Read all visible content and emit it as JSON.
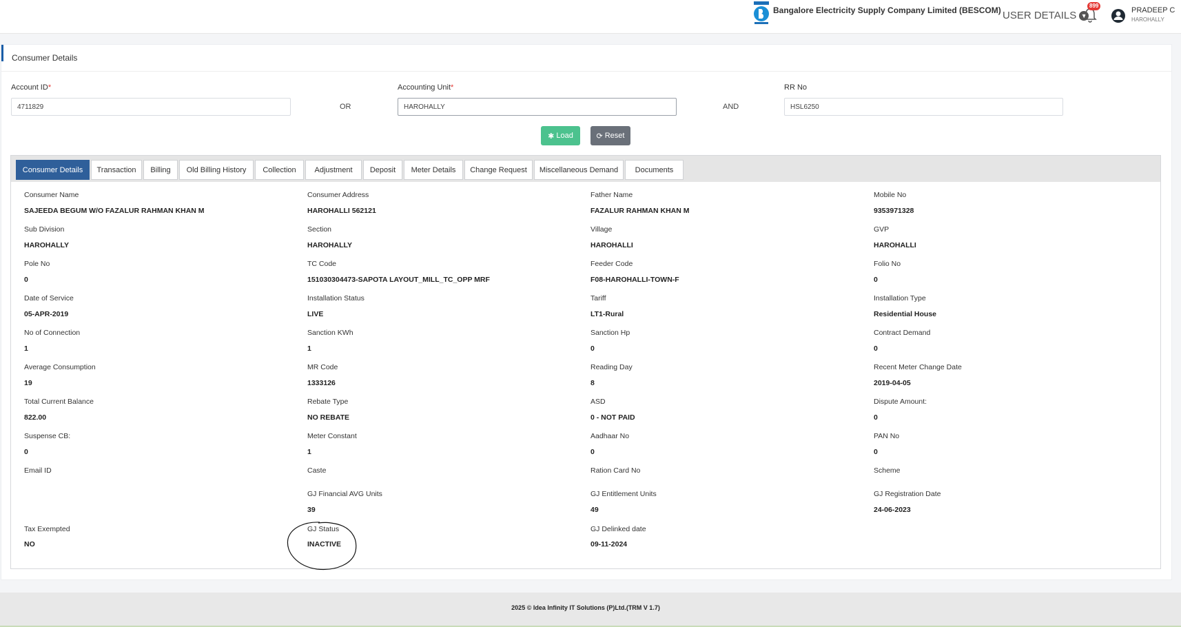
{
  "header": {
    "company_name": "Bangalore Electricity Supply Company Limited (BESCOM)",
    "user_details_label": "USER DETAILS",
    "notification_count": "899",
    "user_name": "PRADEEP C",
    "user_location": "HAROHALLY"
  },
  "page": {
    "title": "Consumer Details"
  },
  "search": {
    "account_id_label": "Account ID",
    "account_id_value": "4711829",
    "or_label": "OR",
    "accounting_unit_label": "Accounting Unit",
    "accounting_unit_value": "HAROHALLY",
    "and_label": "AND",
    "rr_no_label": "RR No",
    "rr_no_value": "HSL6250",
    "required_mark": "*",
    "load_label": "Load",
    "reset_label": "Reset"
  },
  "tabs": [
    {
      "label": "Consumer Details",
      "active": true
    },
    {
      "label": "Transaction"
    },
    {
      "label": "Billing"
    },
    {
      "label": "Old Billing History"
    },
    {
      "label": "Collection"
    },
    {
      "label": "Adjustment"
    },
    {
      "label": "Deposit"
    },
    {
      "label": "Meter Details"
    },
    {
      "label": "Change Request"
    },
    {
      "label": "Miscellaneous Demand"
    },
    {
      "label": "Documents"
    }
  ],
  "details": {
    "consumer_name": {
      "label": "Consumer Name",
      "value": "SAJEEDA BEGUM W/O FAZALUR RAHMAN KHAN M"
    },
    "consumer_address": {
      "label": "Consumer Address",
      "value": "HAROHALLI 562121"
    },
    "father_name": {
      "label": "Father Name",
      "value": "FAZALUR RAHMAN KHAN M"
    },
    "mobile_no": {
      "label": "Mobile No",
      "value": "9353971328"
    },
    "sub_division": {
      "label": "Sub Division",
      "value": "HAROHALLY"
    },
    "section": {
      "label": "Section",
      "value": "HAROHALLY"
    },
    "village": {
      "label": "Village",
      "value": "HAROHALLI"
    },
    "gvp": {
      "label": "GVP",
      "value": "HAROHALLI"
    },
    "pole_no": {
      "label": "Pole No",
      "value": "0"
    },
    "tc_code": {
      "label": "TC Code",
      "value": "151030304473-SAPOTA LAYOUT_MILL_TC_OPP MRF"
    },
    "feeder_code": {
      "label": "Feeder Code",
      "value": "F08-HAROHALLI-TOWN-F"
    },
    "folio_no": {
      "label": "Folio No",
      "value": "0"
    },
    "date_of_service": {
      "label": "Date of Service",
      "value": "05-APR-2019"
    },
    "installation_status": {
      "label": "Installation Status",
      "value": "LIVE"
    },
    "tariff": {
      "label": "Tariff",
      "value": "LT1-Rural"
    },
    "installation_type": {
      "label": "Installation Type",
      "value": "Residential House"
    },
    "no_of_connection": {
      "label": "No of Connection",
      "value": "1"
    },
    "sanction_kwh": {
      "label": "Sanction KWh",
      "value": "1"
    },
    "sanction_hp": {
      "label": "Sanction Hp",
      "value": "0"
    },
    "contract_demand": {
      "label": "Contract Demand",
      "value": "0"
    },
    "average_consumption": {
      "label": "Average Consumption",
      "value": "19"
    },
    "mr_code": {
      "label": "MR Code",
      "value": "1333126"
    },
    "reading_day": {
      "label": "Reading Day",
      "value": "8"
    },
    "recent_meter_change_date": {
      "label": "Recent Meter Change Date",
      "value": "2019-04-05"
    },
    "total_current_balance": {
      "label": "Total Current Balance",
      "value": "822.00"
    },
    "rebate_type": {
      "label": "Rebate Type",
      "value": "NO REBATE"
    },
    "asd": {
      "label": "ASD",
      "value": "0 - NOT PAID"
    },
    "dispute_amount": {
      "label": "Dispute Amount:",
      "value": "0"
    },
    "suspense_cb": {
      "label": "Suspense CB:",
      "value": "0"
    },
    "meter_constant": {
      "label": "Meter Constant",
      "value": "1"
    },
    "aadhaar_no": {
      "label": "Aadhaar No",
      "value": "0"
    },
    "pan_no": {
      "label": "PAN No",
      "value": "0"
    },
    "email_id": {
      "label": "Email ID",
      "value": ""
    },
    "caste": {
      "label": "Caste",
      "value": ""
    },
    "ration_card_no": {
      "label": "Ration Card No",
      "value": ""
    },
    "scheme": {
      "label": "Scheme",
      "value": ""
    },
    "gj_financial_avg_units": {
      "label": "GJ Financial AVG Units",
      "value": "39"
    },
    "gj_entitlement_units": {
      "label": "GJ Entitlement Units",
      "value": "49"
    },
    "gj_registration_date": {
      "label": "GJ Registration Date",
      "value": "24-06-2023"
    },
    "tax_exempted": {
      "label": "Tax Exempted",
      "value": "NO"
    },
    "gj_status": {
      "label": "GJ Status",
      "value": "INACTIVE"
    },
    "gj_delinked_date": {
      "label": "GJ Delinked date",
      "value": "09-11-2024"
    }
  },
  "footer": {
    "text": "2025 © Idea Infinity IT Solutions (P)Ltd.(TRM V 1.7)"
  }
}
